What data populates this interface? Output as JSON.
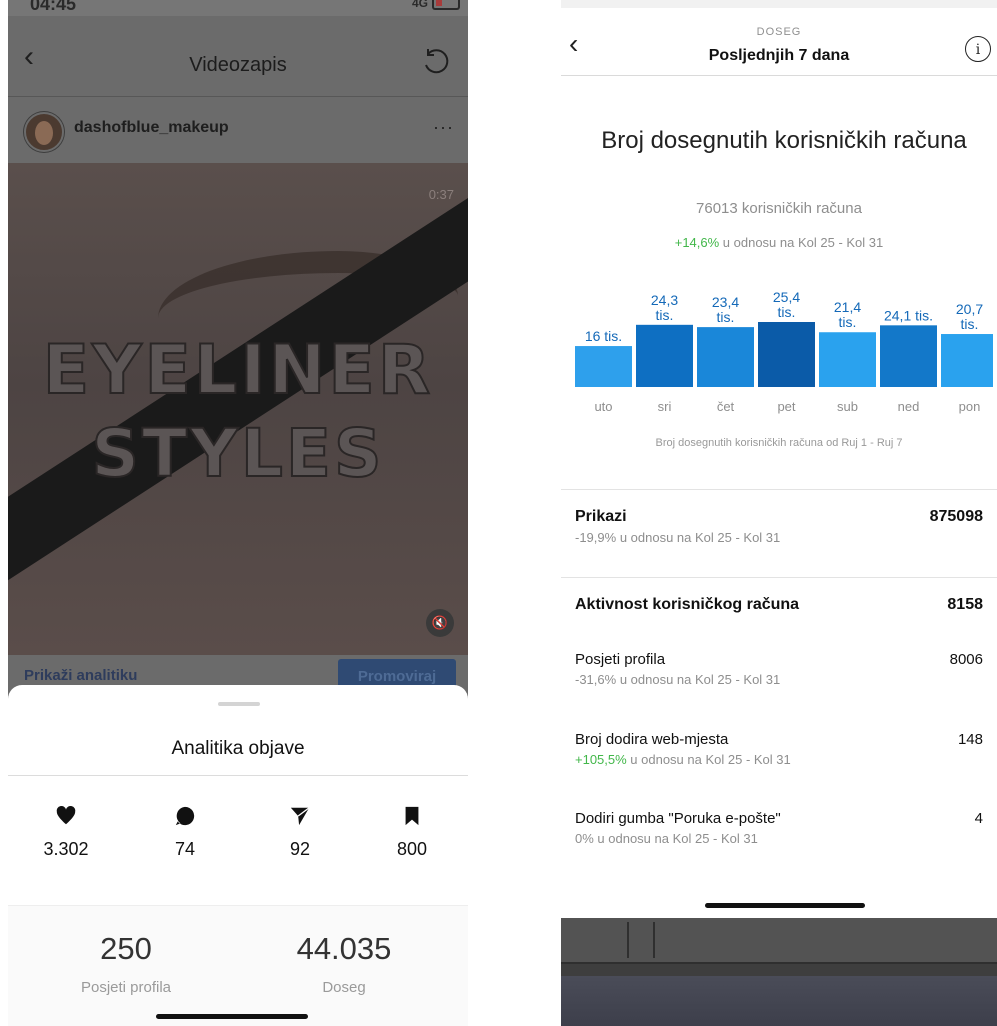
{
  "left_phone": {
    "status_time": "04:45",
    "status_signal": "4G",
    "nav_title": "Videozapis",
    "username": "dashofblue_makeup",
    "more_label": "···",
    "video_duration": "0:37",
    "video_line1": "EYELINER",
    "video_line2": "STYLES",
    "show_analytics_label": "Prikaži analitiku",
    "promote_label": "Promoviraj",
    "sheet_title": "Analitika objave",
    "stats": [
      {
        "icon": "heart-icon",
        "value": "3.302"
      },
      {
        "icon": "comment-icon",
        "value": "74"
      },
      {
        "icon": "send-icon",
        "value": "92"
      },
      {
        "icon": "bookmark-icon",
        "value": "800"
      }
    ],
    "profile_visits": {
      "value": "250",
      "label": "Posjeti profila"
    },
    "reach": {
      "value": "44.035",
      "label": "Doseg"
    }
  },
  "right_phone": {
    "nav_overline": "DOSEG",
    "nav_title": "Posljednjih 7 dana",
    "info_icon": "i",
    "reach_title": "Broj dosegnutih korisničkih računa",
    "reach_total": "76013 korisničkih računa",
    "reach_change_pct": "+14,6%",
    "reach_change_text": " u odnosu na Kol 25 - Kol 31",
    "caption": "Broj dosegnutih korisničkih računa od Ruj 1 - Ruj 7",
    "impressions": {
      "label": "Prikazi",
      "value": "875098",
      "pct": "-19,9%",
      "text": " u odnosu na Kol 25 - Kol 31"
    },
    "account_activity": {
      "label": "Aktivnost korisničkog računa",
      "value": "8158"
    },
    "profile_visits": {
      "label": "Posjeti profila",
      "value": "8006",
      "pct": "-31,6%",
      "text": " u odnosu na Kol 25 - Kol 31"
    },
    "website_taps": {
      "label": "Broj dodira web-mjesta",
      "value": "148",
      "pct": "+105,5%",
      "text": " u odnosu na Kol 25 - Kol 31"
    },
    "email_taps": {
      "label": "Dodiri gumba \"Poruka e-pošte\"",
      "value": "4",
      "pct": "0%",
      "text": " u odnosu na Kol 25 - Kol 31"
    }
  },
  "chart_data": {
    "type": "bar",
    "categories": [
      "uto",
      "sri",
      "čet",
      "pet",
      "sub",
      "ned",
      "pon"
    ],
    "values": [
      16.0,
      24.3,
      23.4,
      25.4,
      21.4,
      24.1,
      20.7
    ],
    "labels": [
      [
        "16 tis."
      ],
      [
        "24,3",
        "tis."
      ],
      [
        "23,4",
        "tis."
      ],
      [
        "25,4",
        "tis."
      ],
      [
        "21,4",
        "tis."
      ],
      [
        "24,1 tis."
      ],
      [
        "20,7",
        "tis."
      ]
    ],
    "colors": [
      "#2ea0ec",
      "#0e6fc2",
      "#1a87d9",
      "#0b5ba8",
      "#2aa2ee",
      "#1378c9",
      "#2aa2ee"
    ],
    "label_color": "#1469b8",
    "unit": "tis."
  }
}
